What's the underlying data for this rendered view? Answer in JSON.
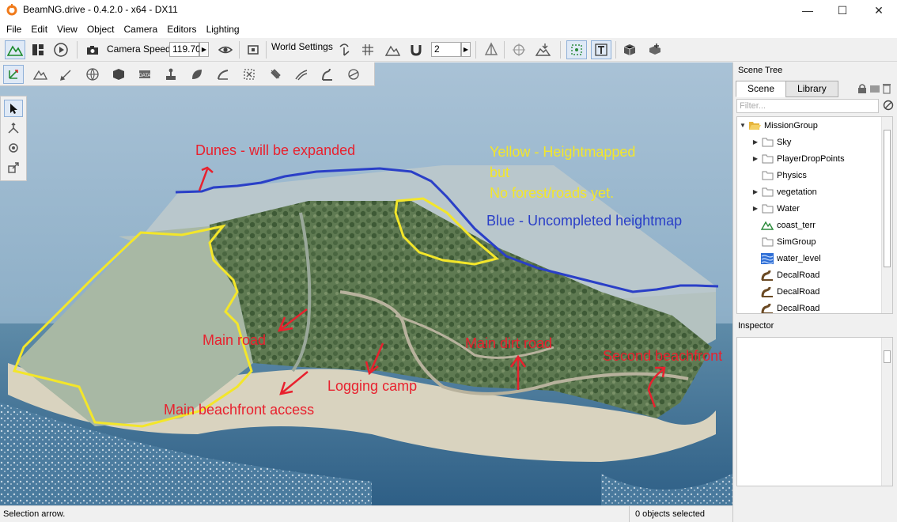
{
  "window": {
    "title": "BeamNG.drive - 0.4.2.0 - x64 - DX11",
    "minimize_glyph": "—",
    "maximize_glyph": "☐",
    "close_glyph": "✕"
  },
  "menu": [
    "File",
    "Edit",
    "View",
    "Object",
    "Camera",
    "Editors",
    "Lighting"
  ],
  "toolbar": {
    "camera_speed_label": "Camera Speed",
    "camera_speed_value": "119.70",
    "world_settings_label": "World Settings",
    "snap_value": "2"
  },
  "annotations": {
    "dunes": "Dunes - will be expanded",
    "yellow_1": "Yellow - Heightmapped",
    "yellow_2": "but",
    "yellow_3": "No forest/roads yet.",
    "blue": "Blue - Uncompleted heightmap",
    "main_road": "Main road",
    "main_dirt_road": "Main dirt road",
    "second_beachfront": "Second beachfront",
    "logging_camp": "Logging camp",
    "main_beachfront": "Main beachfront access"
  },
  "colors": {
    "annotation_red": "#e8212e",
    "annotation_yellow": "#f3e62a",
    "annotation_blue": "#2a3fc7"
  },
  "scene_tree": {
    "title": "Scene Tree",
    "tabs": [
      "Scene",
      "Library"
    ],
    "filter_placeholder": "Filter...",
    "items": [
      {
        "label": "MissionGroup",
        "icon": "folder-open-icon"
      },
      {
        "label": "Sky",
        "icon": "folder-icon"
      },
      {
        "label": "PlayerDropPoints",
        "icon": "folder-icon"
      },
      {
        "label": "Physics",
        "icon": "folder-icon"
      },
      {
        "label": "vegetation",
        "icon": "folder-icon"
      },
      {
        "label": "Water",
        "icon": "folder-icon"
      },
      {
        "label": "coast_terr",
        "icon": "terrain-icon"
      },
      {
        "label": "SimGroup",
        "icon": "folder-icon"
      },
      {
        "label": "water_level",
        "icon": "water-icon"
      },
      {
        "label": "DecalRoad",
        "icon": "decal-road-icon"
      },
      {
        "label": "DecalRoad",
        "icon": "decal-road-icon"
      },
      {
        "label": "DecalRoad",
        "icon": "decal-road-icon"
      }
    ]
  },
  "inspector": {
    "title": "Inspector"
  },
  "status": {
    "left": "Selection arrow.",
    "right": "0 objects selected"
  }
}
